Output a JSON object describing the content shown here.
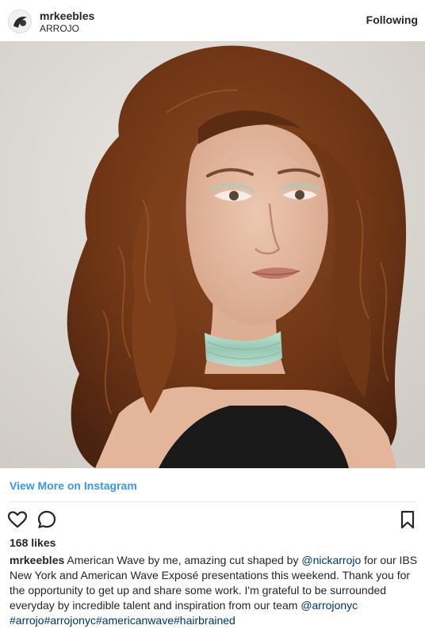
{
  "header": {
    "username": "mrkeebles",
    "location": "ARROJO",
    "follow_label": "Following"
  },
  "photo": {
    "description_icon": "portrait-photo"
  },
  "view_more_label": "View More on Instagram",
  "actions": {
    "like_icon": "heart-icon",
    "comment_icon": "comment-icon",
    "save_icon": "bookmark-icon"
  },
  "likes_label": "168 likes",
  "caption": {
    "username": "mrkeebles",
    "text_1": " American Wave by me, amazing cut shaped by ",
    "mention_1": "@nickarrojo",
    "text_2": " for our IBS New York and American Wave Exposé presentations this weekend. Thank you for the opportunity to get up and share some work. I'm grateful to be surrounded everyday by incredible talent and inspiration from our team ",
    "mention_2": "@arrojonyc",
    "text_3": " ",
    "hashtags": "#arrojo#arrojonyc#americanwave#hairbrained"
  },
  "colors": {
    "link_blue": "#3897f0",
    "text": "#262626",
    "mention": "#003569",
    "choker": "#a9d4c3"
  }
}
